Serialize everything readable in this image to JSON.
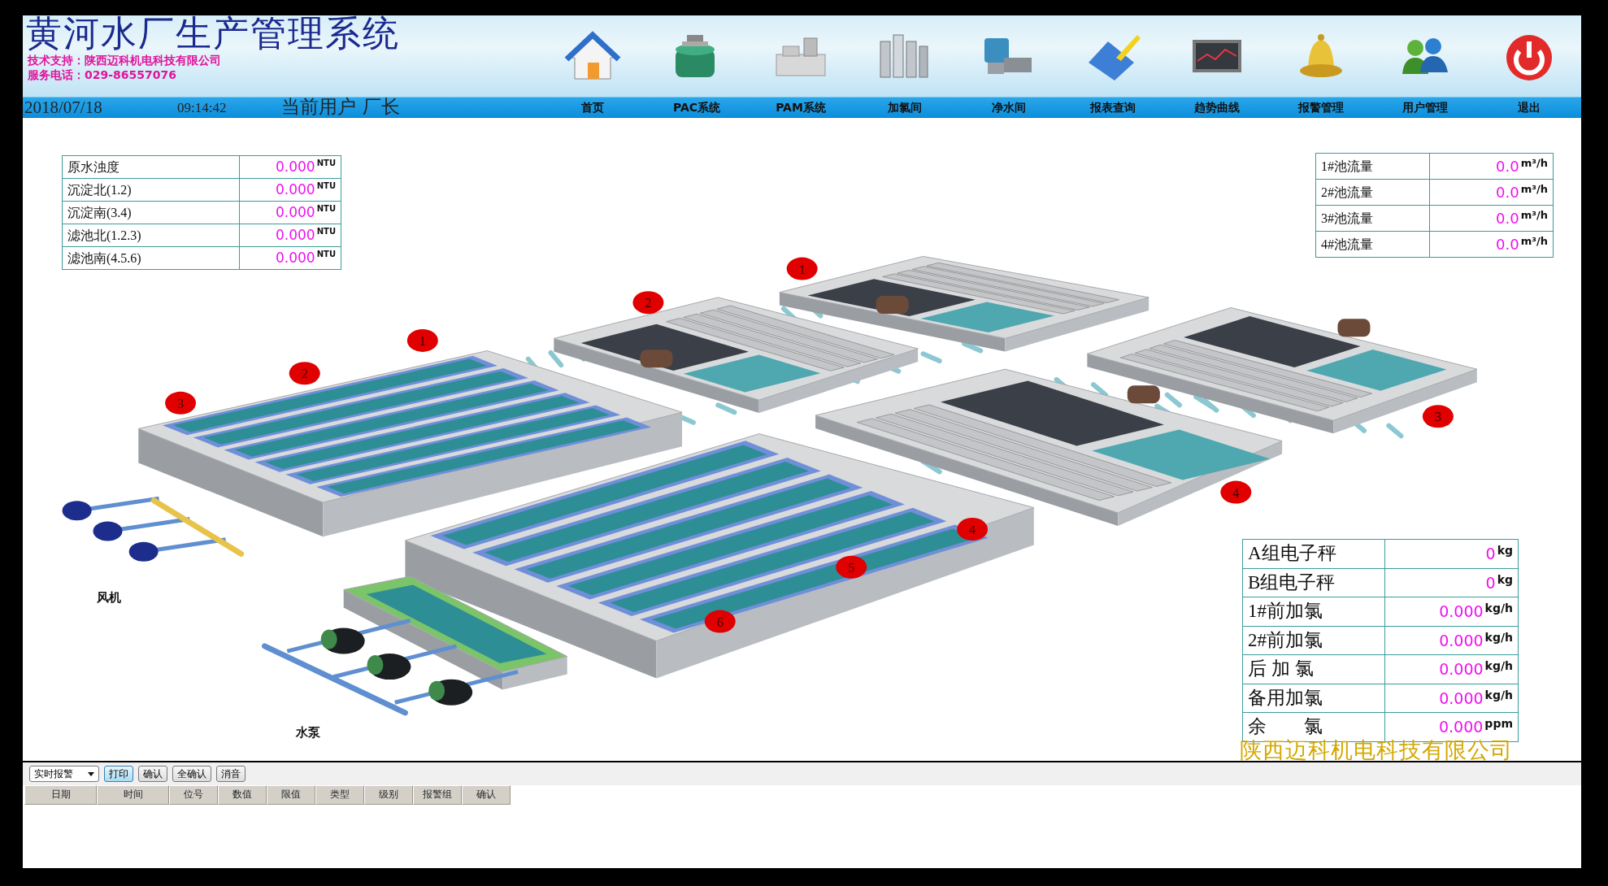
{
  "header": {
    "title": "黄河水厂生产管理系统",
    "support": "技术支持：陕西迈科机电科技有限公司",
    "phone": "服务电话：029-86557076",
    "date": "2018/07/18",
    "time": "09:14:42",
    "user_label": "当前用户",
    "user": "厂长"
  },
  "nav": [
    {
      "label": "首页",
      "kind": "house"
    },
    {
      "label": "PAC系统",
      "kind": "filter"
    },
    {
      "label": "PAM系统",
      "kind": "machine"
    },
    {
      "label": "加氯间",
      "kind": "equipment"
    },
    {
      "label": "净水间",
      "kind": "pump"
    },
    {
      "label": "报表查询",
      "kind": "pen"
    },
    {
      "label": "趋势曲线",
      "kind": "monitor"
    },
    {
      "label": "报警管理",
      "kind": "bell"
    },
    {
      "label": "用户管理",
      "kind": "users"
    },
    {
      "label": "退出",
      "kind": "power"
    }
  ],
  "turbidity_table": [
    {
      "label": "原水浊度",
      "value": "0.000",
      "unit": "NTU"
    },
    {
      "label": "沉淀北(1.2)",
      "value": "0.000",
      "unit": "NTU"
    },
    {
      "label": "沉淀南(3.4)",
      "value": "0.000",
      "unit": "NTU"
    },
    {
      "label": "滤池北(1.2.3)",
      "value": "0.000",
      "unit": "NTU"
    },
    {
      "label": "滤池南(4.5.6)",
      "value": "0.000",
      "unit": "NTU"
    }
  ],
  "flow_table": [
    {
      "label": "1#池流量",
      "value": "0.0",
      "unit": "m³/h"
    },
    {
      "label": "2#池流量",
      "value": "0.0",
      "unit": "m³/h"
    },
    {
      "label": "3#池流量",
      "value": "0.0",
      "unit": "m³/h"
    },
    {
      "label": "4#池流量",
      "value": "0.0",
      "unit": "m³/h"
    }
  ],
  "dosing_table": [
    {
      "label": "A组电子秤",
      "value": "0",
      "unit": "kg"
    },
    {
      "label": "B组电子秤",
      "value": "0",
      "unit": "kg"
    },
    {
      "label": "1#前加氯",
      "value": "0.000",
      "unit": "kg/h"
    },
    {
      "label": "2#前加氯",
      "value": "0.000",
      "unit": "kg/h"
    },
    {
      "label": "后 加 氯",
      "value": "0.000",
      "unit": "kg/h"
    },
    {
      "label": "备用加氯",
      "value": "0.000",
      "unit": "kg/h"
    },
    {
      "label": "余　　氯",
      "value": "0.000",
      "unit": "ppm"
    }
  ],
  "plant": {
    "markers": [
      "1",
      "2",
      "3",
      "4",
      "5",
      "6",
      "1",
      "2",
      "3",
      "4"
    ],
    "labels": [
      "风机",
      "水泵"
    ]
  },
  "company_label": "陕西迈科机电科技有限公司",
  "alarm_panel": {
    "mode": "实时报警",
    "buttons": [
      {
        "label": "打印",
        "selected": true
      },
      {
        "label": "确认",
        "selected": false
      },
      {
        "label": "全确认",
        "selected": false
      },
      {
        "label": "消音",
        "selected": false
      }
    ],
    "columns": [
      "日期",
      "时间",
      "位号",
      "数值",
      "限值",
      "类型",
      "级别",
      "报警组",
      "确认"
    ]
  }
}
